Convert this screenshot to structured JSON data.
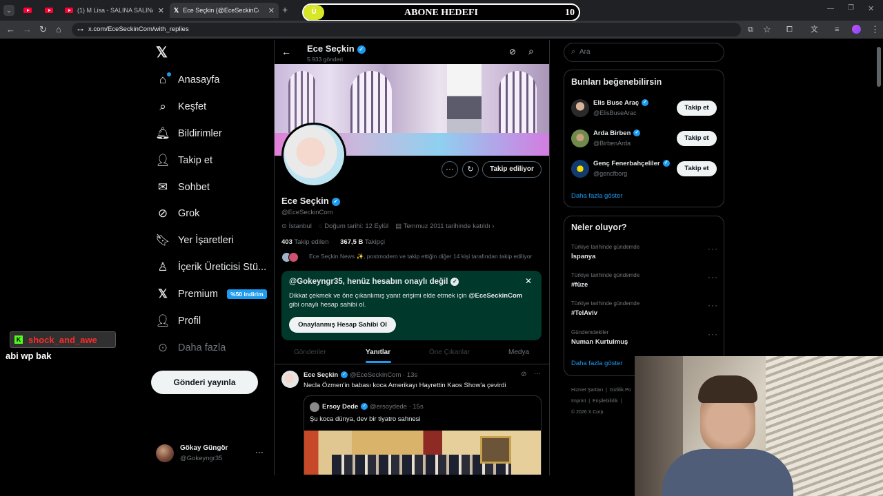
{
  "browser": {
    "tabs": [
      {
        "label": ""
      },
      {
        "label": ""
      },
      {
        "label": "(1) M Lisa - SALINA SALINA (OI"
      },
      {
        "label": "Ece Seçkin (@EceSeckinCom) a"
      }
    ],
    "url": "x.com/EceSeckinCom/with_replies"
  },
  "overlay": {
    "goal_title": "ABONE HEDEFI",
    "goal_count": "10",
    "goal_badge": "Ü",
    "chat_user": "shock_and_awe",
    "chat_message": "abi wp bak"
  },
  "sidebar": {
    "items": [
      {
        "label": "Anasayfa"
      },
      {
        "label": "Keşfet"
      },
      {
        "label": "Bildirimler"
      },
      {
        "label": "Takip et"
      },
      {
        "label": "Sohbet"
      },
      {
        "label": "Grok"
      },
      {
        "label": "Yer İşaretleri"
      },
      {
        "label": "İçerik Üreticisi Stü..."
      },
      {
        "label": "Premium"
      },
      {
        "label": "Profil"
      },
      {
        "label": "Daha fazla"
      }
    ],
    "premium_badge": "%50 indirim",
    "post_button": "Gönderi yayınla",
    "account": {
      "name": "Gökay Güngör",
      "handle": "@Gokeyngr35"
    }
  },
  "profile": {
    "header_name": "Ece Seçkin",
    "post_count": "5.933 gönderi",
    "name": "Ece Seçkin",
    "handle": "@EceSeckinCom",
    "location": "İstanbul",
    "birthday": "Doğum tarihi: 12 Eylül",
    "joined": "Temmuz 2011 tarihinde katıldı",
    "following_count": "403",
    "following_label": "Takip edilen",
    "followers_count": "367,5 B",
    "followers_label": "Takipçi",
    "followed_by": "Ece Seçkin News ✨, postmodern ve takip ettiğin diğer 14 kişi tarafından takip ediliyor",
    "follow_state": "Takip ediliyor"
  },
  "promo": {
    "title": "@Gokeyngr35, henüz hesabın onaylı değil",
    "text_before": "Dikkat çekmek ve öne çıkanlımış yanıt erişimi elde etmek için",
    "text_handle": "@EceSeckinCom",
    "text_after": "gibi onaylı hesap sahibi ol.",
    "button": "Onaylanmış Hesap Sahibi Ol"
  },
  "profile_tabs": [
    "Gönderiler",
    "Yanıtlar",
    "Öne Çıkanlar",
    "Medya"
  ],
  "tweet": {
    "name": "Ece Seçkin",
    "handle": "@EceSeckinCom",
    "time": "· 13s",
    "text": "Necla Özmen'in babası koca Amerikayı Hayrettin Kaos Show'a çevirdi",
    "quote": {
      "name": "Ersoy Dede",
      "handle": "@ersoydede",
      "time": "· 15s",
      "text": "Şu koca dünya, dev bir tiyatro sahnesi"
    }
  },
  "search": {
    "placeholder": "Ara"
  },
  "suggestions": {
    "title": "Bunları beğenebilirsin",
    "users": [
      {
        "name": "Elis Buse Araç",
        "handle": "@ElisBuseArac",
        "button": "Takip et"
      },
      {
        "name": "Arda Birben",
        "handle": "@BirbenArda",
        "button": "Takip et"
      },
      {
        "name": "Genç Fenerbahçeliler",
        "handle": "@gencfborg",
        "button": "Takip et"
      }
    ],
    "more": "Daha fazla göster"
  },
  "trends": {
    "title": "Neler oluyor?",
    "items": [
      {
        "context": "Türkiye tarihinde gündemde",
        "topic": "İspanya"
      },
      {
        "context": "Türkiye tarihinde gündemde",
        "topic": "#füze"
      },
      {
        "context": "Türkiye tarihinde gündemde",
        "topic": "#TelAviv"
      },
      {
        "context": "Gündemdekiler",
        "topic": "Numan Kurtulmuş"
      }
    ],
    "more": "Daha fazla göster"
  },
  "footer": {
    "line1": [
      "Hizmet Şartları",
      "Gizlilik Po"
    ],
    "line2": [
      "Imprint",
      "Erişilebilirlik"
    ],
    "copyright": "© 2026 X Corp."
  },
  "colors": {
    "accent": "#1d9bf0",
    "promo_bg": "#00382b",
    "premium_badge": "#1d9bf0"
  }
}
